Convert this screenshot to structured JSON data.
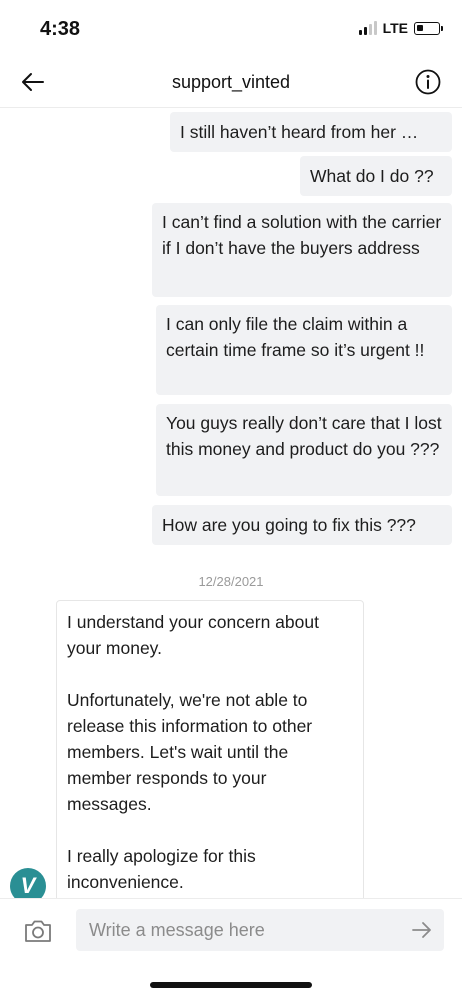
{
  "status_bar": {
    "time": "4:38",
    "network": "LTE"
  },
  "header": {
    "title": "support_vinted"
  },
  "outgoing_messages": [
    {
      "text": "I still haven’t heard from her …"
    },
    {
      "text": "What do I do ??"
    },
    {
      "text": "I can’t find a solution with the carrier if I don’t have the buyers address"
    },
    {
      "text": "I can only file the claim within a certain time frame so it’s urgent !!"
    },
    {
      "text": "You guys really don’t care that I lost this money and product do you ???"
    },
    {
      "text": "How are you going to fix this ???"
    }
  ],
  "date_separator": "12/28/2021",
  "incoming_message": {
    "paragraphs": [
      "I understand your concern about your money.",
      "Unfortunately, we're not able to release this information to other members. Let's wait until the member responds to your messages.",
      "I really apologize for this inconvenience."
    ]
  },
  "avatar": {
    "letter": "V",
    "color": "#2a8f94"
  },
  "composer": {
    "placeholder": "Write a message here",
    "value": ""
  },
  "icons": {
    "back": "arrow-left-icon",
    "info": "info-circle-icon",
    "camera": "camera-icon",
    "send": "arrow-right-icon"
  }
}
